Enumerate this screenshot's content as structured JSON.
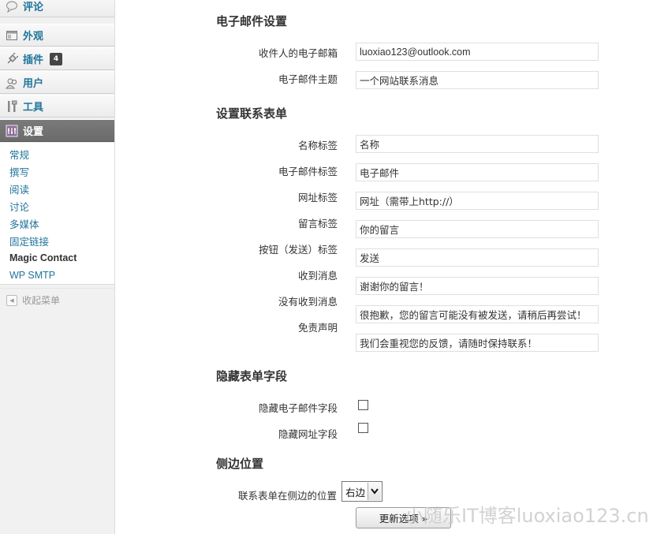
{
  "sidebar": {
    "menu": [
      {
        "label": "评论",
        "icon": "comment-icon"
      },
      {
        "label": "外观",
        "icon": "appearance-icon"
      },
      {
        "label": "插件",
        "icon": "plugin-icon",
        "badge": "4"
      },
      {
        "label": "用户",
        "icon": "users-icon"
      },
      {
        "label": "工具",
        "icon": "tools-icon"
      },
      {
        "label": "设置",
        "icon": "settings-icon"
      }
    ],
    "submenu": [
      "常规",
      "撰写",
      "阅读",
      "讨论",
      "多媒体",
      "固定链接",
      "Magic Contact",
      "WP SMTP"
    ],
    "current_submenu": "Magic Contact",
    "collapse_label": "收起菜单"
  },
  "sections": {
    "email": {
      "title": "电子邮件设置",
      "recipient_label": "收件人的电子邮箱",
      "recipient_value": "luoxiao123@outlook.com",
      "subject_label": "电子邮件主题",
      "subject_value": "一个网站联系消息"
    },
    "form": {
      "title": "设置联系表单",
      "name_label": "名称标签",
      "name_value": "名称",
      "email_label": "电子邮件标签",
      "email_value": "电子邮件",
      "url_label": "网址标签",
      "url_value": "网址（需带上http://）",
      "message_label": "留言标签",
      "message_value": "你的留言",
      "button_label": "按钮（发送）标签",
      "button_value": "发送",
      "received_label": "收到消息",
      "received_value": "谢谢你的留言！",
      "not_received_label": "没有收到消息",
      "not_received_value": "很抱歉，您的留言可能没有被发送，请稍后再尝试！",
      "disclaimer_label": "免责声明",
      "disclaimer_value": "我们会重视您的反馈，请随时保持联系！"
    },
    "hide": {
      "title": "隐藏表单字段",
      "hide_email_label": "隐藏电子邮件字段",
      "hide_email_checked": false,
      "hide_url_label": "隐藏网址字段",
      "hide_url_checked": false
    },
    "sidebar_position": {
      "title": "侧边位置",
      "position_label": "联系表单在侧边的位置",
      "position_value": "右边"
    }
  },
  "update_button": "更新选项 »",
  "watermark": "小随乐IT博客luoxiao123.cn",
  "colors": {
    "link": "#21759b",
    "current_menu_bg": "#6f6f6f",
    "sidebar_bg": "#f1f1f1"
  }
}
